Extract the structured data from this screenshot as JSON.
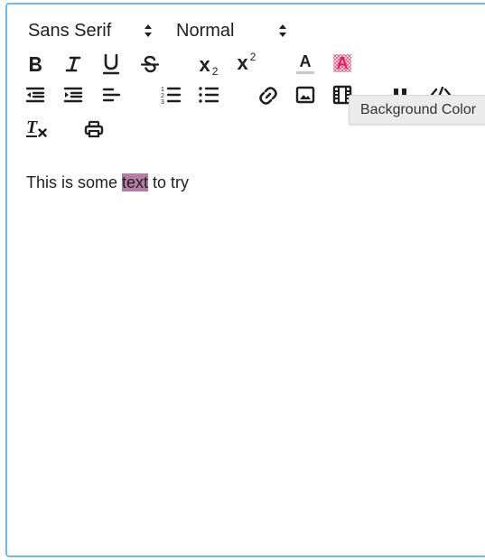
{
  "toolbar": {
    "font_picker": {
      "value": "Sans Serif",
      "icon": "up-down-arrows-icon"
    },
    "size_picker": {
      "value": "Normal",
      "icon": "up-down-arrows-icon"
    },
    "subscript": {
      "base": "x",
      "sub": "2"
    },
    "superscript": {
      "base": "x",
      "sup": "2"
    },
    "color_letter": "A",
    "background_letter": "A",
    "clean_letter": "T",
    "accent_color": "#e8195c"
  },
  "tooltip": {
    "text": "Background Color"
  },
  "editor": {
    "before": "This is some ",
    "highlighted": "text",
    "after": " to try",
    "highlight_color": "#b47ea4"
  },
  "colors": {
    "frame_border": "#6fb8ee",
    "icon": "#1f1f1f"
  }
}
